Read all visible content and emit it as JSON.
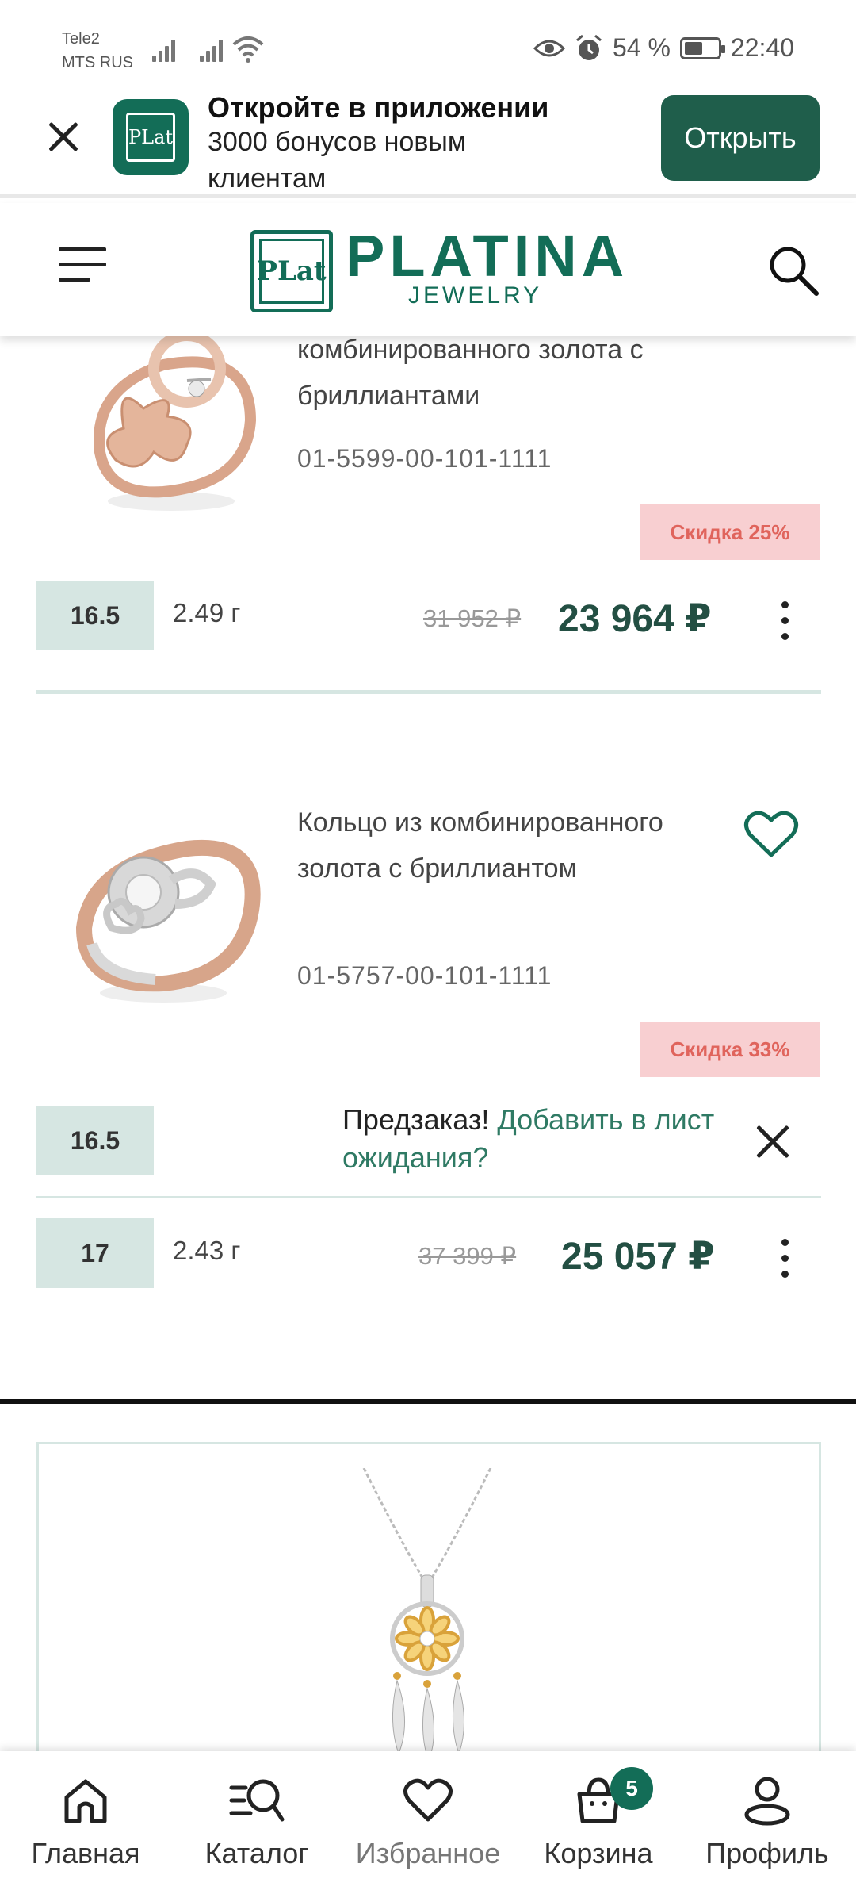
{
  "status_bar": {
    "carrier_1": "Tele2",
    "carrier_2": "MTS RUS",
    "battery": "54 %",
    "time": "22:40"
  },
  "promo": {
    "title": "Откройте в приложении",
    "subtitle": "3000 бонусов новым клиентам",
    "open_label": "Открыть",
    "logo_text": "PLat"
  },
  "header": {
    "brand": "PLATINA",
    "brand_sub": "JEWELRY",
    "logo_text": "PLat"
  },
  "products": [
    {
      "title_visible": "комбинированного золота с бриллиантами",
      "sku": "01-5599-00-101-1111",
      "discount": "Скидка 25%",
      "sizes": [
        {
          "size": "16.5",
          "weight": "2.49 г",
          "old_price": "31 952 ₽",
          "price": "23 964 ₽"
        }
      ]
    },
    {
      "title": "Кольцо из комбинированного золота с бриллиантом",
      "sku": "01-5757-00-101-1111",
      "discount": "Скидка 33%",
      "preorder_text": "Предзаказ!",
      "preorder_link": "Добавить в лист ожидания?",
      "sizes": [
        {
          "size": "16.5"
        },
        {
          "size": "17",
          "weight": "2.43 г",
          "old_price": "37 399 ₽",
          "price": "25 057 ₽"
        }
      ]
    }
  ],
  "bottom_nav": {
    "home": "Главная",
    "catalog": "Каталог",
    "favorites": "Избранное",
    "cart": "Корзина",
    "cart_count": "5",
    "profile": "Профиль"
  },
  "colors": {
    "brand_green": "#136d57",
    "dark_green": "#1f5e4b",
    "size_bg": "#d6e6e2",
    "discount_bg": "#f8cfd1",
    "discount_text": "#e0645c"
  }
}
